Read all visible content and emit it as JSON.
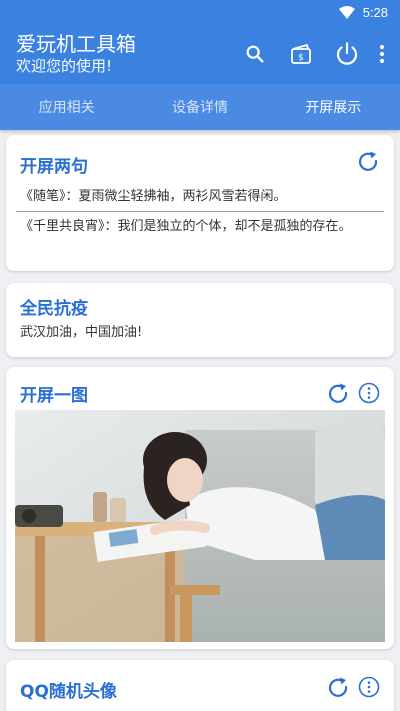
{
  "status_bar": {
    "time": "5:28"
  },
  "app_bar": {
    "title": "爱玩机工具箱",
    "subtitle": "欢迎您的使用!",
    "icons": [
      "search-icon",
      "wallet-icon",
      "power-icon",
      "more-vert-icon"
    ]
  },
  "tabs": [
    {
      "label": "应用相关",
      "active": false
    },
    {
      "label": "设备详情",
      "active": false
    },
    {
      "label": "开屏展示",
      "active": true
    }
  ],
  "cards": {
    "quotes": {
      "title": "开屏两句",
      "line1": "《随笔》：夏雨微尘轻拂袖，两衫风雪若得闲。",
      "line2": "《千里共良宵》：我们是独立的个体，却不是孤独的存在。"
    },
    "fight": {
      "title": "全民抗疫",
      "text": "武汉加油，中国加油!"
    },
    "image": {
      "title": "开屏一图"
    },
    "avatar": {
      "title": "QQ随机头像"
    }
  },
  "colors": {
    "primary": "#3b82e0",
    "tab_bg": "#4a8ae2",
    "accent": "#2a6fd3"
  }
}
